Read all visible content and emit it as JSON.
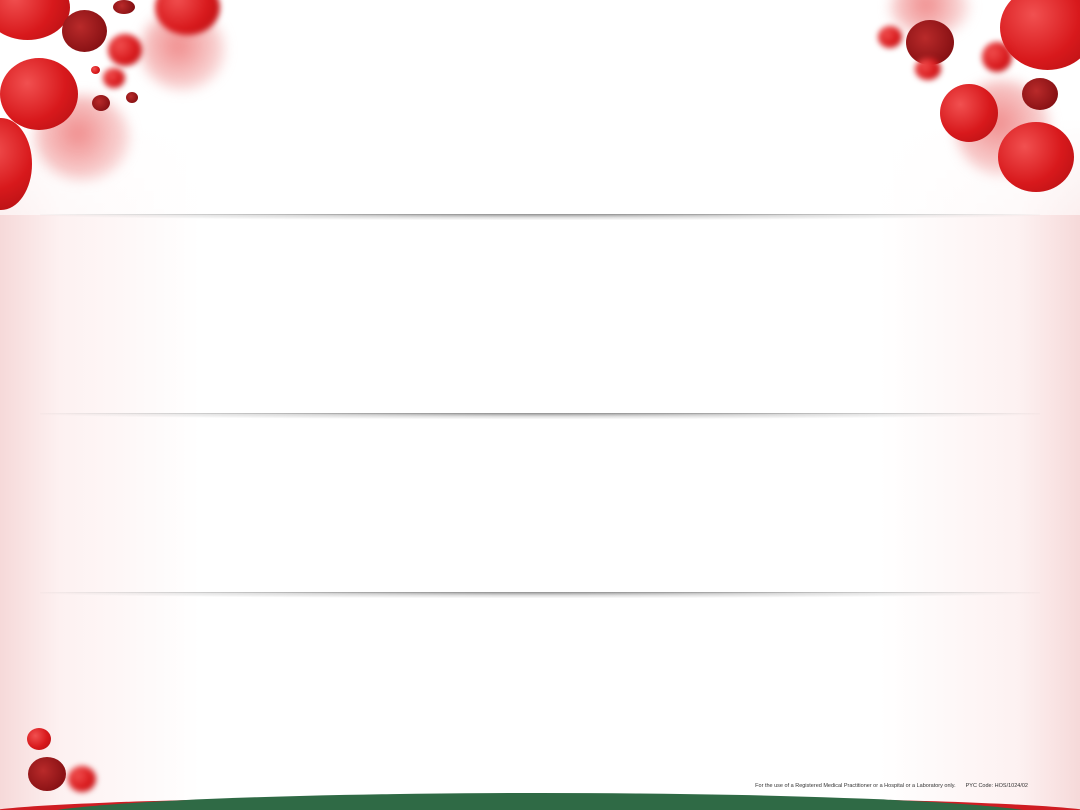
{
  "footer": {
    "disclaimer": "For the use of a Registered Medical Practitioner or a Hospital or a Laboratory only.",
    "code": "PYC Code:  HOS/1024/02"
  },
  "colors": {
    "cell_red": "#d8191c",
    "cell_dark": "#8a1215",
    "band_green": "#2f6a45",
    "band_red": "#cf1c22"
  }
}
